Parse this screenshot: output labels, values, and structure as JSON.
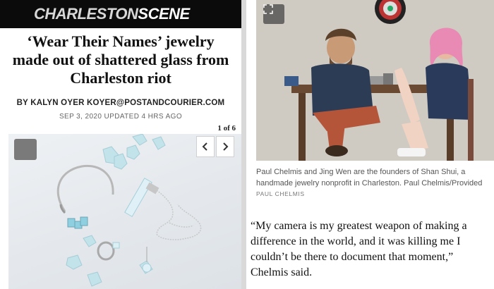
{
  "left": {
    "masthead": {
      "logo_part1": "CHARLESTON",
      "logo_part2": "SCENE"
    },
    "headline": "‘Wear Their Names’ jewelry made out of shattered glass from Charleston riot",
    "byline": "BY KALYN OYER KOYER@POSTANDCOURIER.COM",
    "dateline": "SEP 3, 2020 UPDATED 4 HRS AGO",
    "gallery": {
      "counter": "1 of 6",
      "expand_icon": "expand-icon",
      "prev_icon": "chevron-left-icon",
      "next_icon": "chevron-right-icon"
    }
  },
  "right": {
    "photo": {
      "expand_icon": "fullscreen-corners-icon"
    },
    "caption": "Paul Chelmis and Jing Wen are the founders of Shan Shui, a handmade jewelry nonprofit in Charleston. Paul Chelmis/Provided",
    "credit": "PAUL CHELMIS",
    "quote": "“My camera is my greatest weapon of making a difference in the world, and it was killing me I couldn’t be there to document that moment,” Chelmis said."
  },
  "colors": {
    "masthead_bg": "#0b0b0b",
    "page_bg": "#ffffff",
    "divider": "#d9d9d9",
    "pink_hair": "#e88ab3",
    "shirt_blue": "#2d3c55",
    "pants_rust": "#b4553a"
  }
}
